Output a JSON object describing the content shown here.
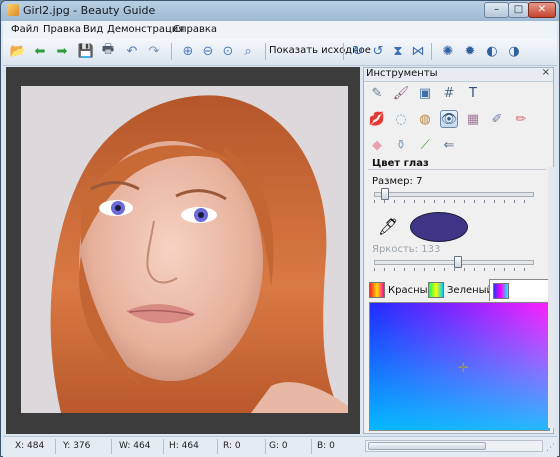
{
  "window": {
    "title": "Girl2.jpg - Beauty Guide",
    "min_label": "–",
    "max_label": "□",
    "close_label": "✕"
  },
  "menu": [
    "Файл",
    "Правка",
    "Вид",
    "Демонстрация",
    "Справка"
  ],
  "toolbar": {
    "show_original": "Показать исходное",
    "icons": [
      "open-icon",
      "back-arrow-icon",
      "forward-arrow-icon",
      "save-icon",
      "print-icon",
      "undo-icon",
      "redo-icon",
      "zoom-in-icon",
      "zoom-out-icon",
      "zoom-fit-icon",
      "zoom-actual-icon",
      "rotate-cw-icon",
      "rotate-ccw-icon",
      "flip-vertical-icon",
      "flip-horizontal-icon",
      "brightness-icon",
      "settings-icon",
      "contrast-icon",
      "saturation-icon"
    ],
    "glyphs": [
      "📂",
      "⬅",
      "➡",
      "💾",
      "🖶",
      "↶",
      "↷",
      "⊕",
      "⊖",
      "⊙",
      "⌕",
      "↻",
      "↺",
      "⧗",
      "⋈",
      "✺",
      "✹",
      "◐",
      "◑"
    ]
  },
  "tools_panel": {
    "title": "Инструменты",
    "close": "×",
    "tools": [
      {
        "name": "pencil-tool-icon",
        "glyph": "✎",
        "color": "#6a7f95"
      },
      {
        "name": "brush-tool-icon",
        "glyph": "🖌",
        "color": "#8a5a7a"
      },
      {
        "name": "crop-tool-icon",
        "glyph": "▣",
        "color": "#3e6fa8"
      },
      {
        "name": "grid-tool-icon",
        "glyph": "#",
        "color": "#5a6f8a"
      },
      {
        "name": "text-tool-icon",
        "glyph": "T",
        "color": "#2f4f7f"
      },
      {
        "name": "lipstick-tool-icon",
        "glyph": "💋",
        "color": "#d06a80"
      },
      {
        "name": "sponge-tool-icon",
        "glyph": "◌",
        "color": "#7aa4c9"
      },
      {
        "name": "makeup-tool-icon",
        "glyph": "◍",
        "color": "#b9863c"
      },
      {
        "name": "eye-color-tool-icon",
        "glyph": "👁",
        "color": "#35557a"
      },
      {
        "name": "shadow-tool-icon",
        "glyph": "▦",
        "color": "#a07a9a"
      },
      {
        "name": "blush-tool-icon",
        "glyph": "✐",
        "color": "#6d86a4"
      },
      {
        "name": "nail-tool-icon",
        "glyph": "✏",
        "color": "#d76a72"
      },
      {
        "name": "eraser-tool-icon",
        "glyph": "◆",
        "color": "#e9a1b1"
      },
      {
        "name": "bottle-tool-icon",
        "glyph": "⚱",
        "color": "#8aa6c4"
      },
      {
        "name": "hair-tool-icon",
        "glyph": "⟋",
        "color": "#4f9a45"
      },
      {
        "name": "reset-tool-icon",
        "glyph": "⇐",
        "color": "#5a6f8f"
      }
    ],
    "section": "Цвет глаз",
    "size_label": "Размер: 7",
    "size_fraction": 0.06,
    "brightness_label": "Яркость: 133",
    "brightness_fraction": 0.52,
    "swatch_color": "#3f3586",
    "tabs": [
      {
        "label": "Красный",
        "active": false
      },
      {
        "label": "Зеленый",
        "active": false
      },
      {
        "label": "",
        "active": true
      }
    ]
  },
  "status": {
    "x": "X: 484",
    "y": "Y: 376",
    "w": "W: 464",
    "h": "H: 464",
    "r": "R: 0",
    "g": "G: 0",
    "b": "B: 0"
  }
}
